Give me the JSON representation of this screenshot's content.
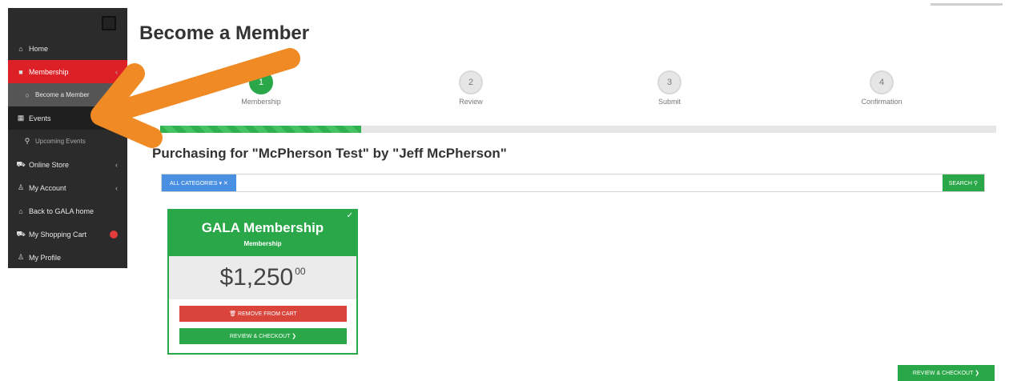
{
  "sidebar": {
    "items": [
      {
        "icon": "home-icon",
        "glyph": "⌂",
        "label": "Home"
      },
      {
        "icon": "bookmark-icon",
        "glyph": "■",
        "label": "Membership",
        "chevron": "‹"
      },
      {
        "icon": "circle-icon",
        "glyph": "○",
        "label": "Become a Member"
      },
      {
        "icon": "calendar-icon",
        "glyph": "▦",
        "label": "Events"
      },
      {
        "icon": "search-icon",
        "glyph": "⚲",
        "label": "Upcoming Events"
      },
      {
        "icon": "cart-icon",
        "glyph": "⛟",
        "label": "Online Store",
        "chevron": "‹"
      },
      {
        "icon": "user-icon",
        "glyph": "♙",
        "label": "My Account",
        "chevron": "‹"
      },
      {
        "icon": "home-icon",
        "glyph": "⌂",
        "label": "Back to GALA home"
      },
      {
        "icon": "cart-icon",
        "glyph": "⛟",
        "label": "My Shopping Cart"
      },
      {
        "icon": "user-icon",
        "glyph": "♙",
        "label": "My Profile"
      }
    ]
  },
  "page": {
    "title": "Become a Member",
    "purchasing": "Purchasing for \"McPherson Test\" by \"Jeff McPherson\""
  },
  "steps": [
    {
      "num": "1",
      "label": "Membership",
      "done": true
    },
    {
      "num": "2",
      "label": "Review",
      "done": false
    },
    {
      "num": "3",
      "label": "Submit",
      "done": false
    },
    {
      "num": "4",
      "label": "Confirmation",
      "done": false
    }
  ],
  "progress": {
    "fraction": 0.24
  },
  "search": {
    "category_label": "ALL CATEGORIES ▾ ✕",
    "placeholder": "",
    "button_label": "SEARCH ⚲"
  },
  "card": {
    "title": "GALA Membership",
    "subtitle": "Membership",
    "price_main": "$1,250",
    "price_cents": "00",
    "remove_label": "🗑 REMOVE FROM CART",
    "review_label": "REVIEW & CHECKOUT ❯",
    "check": "✓"
  },
  "bottom_button": {
    "label": "REVIEW & CHECKOUT ❯"
  },
  "colors": {
    "accent_green": "#2aa748",
    "active_red": "#dd1f26",
    "arrow_orange": "#f08a24",
    "category_blue": "#4a90e2"
  }
}
